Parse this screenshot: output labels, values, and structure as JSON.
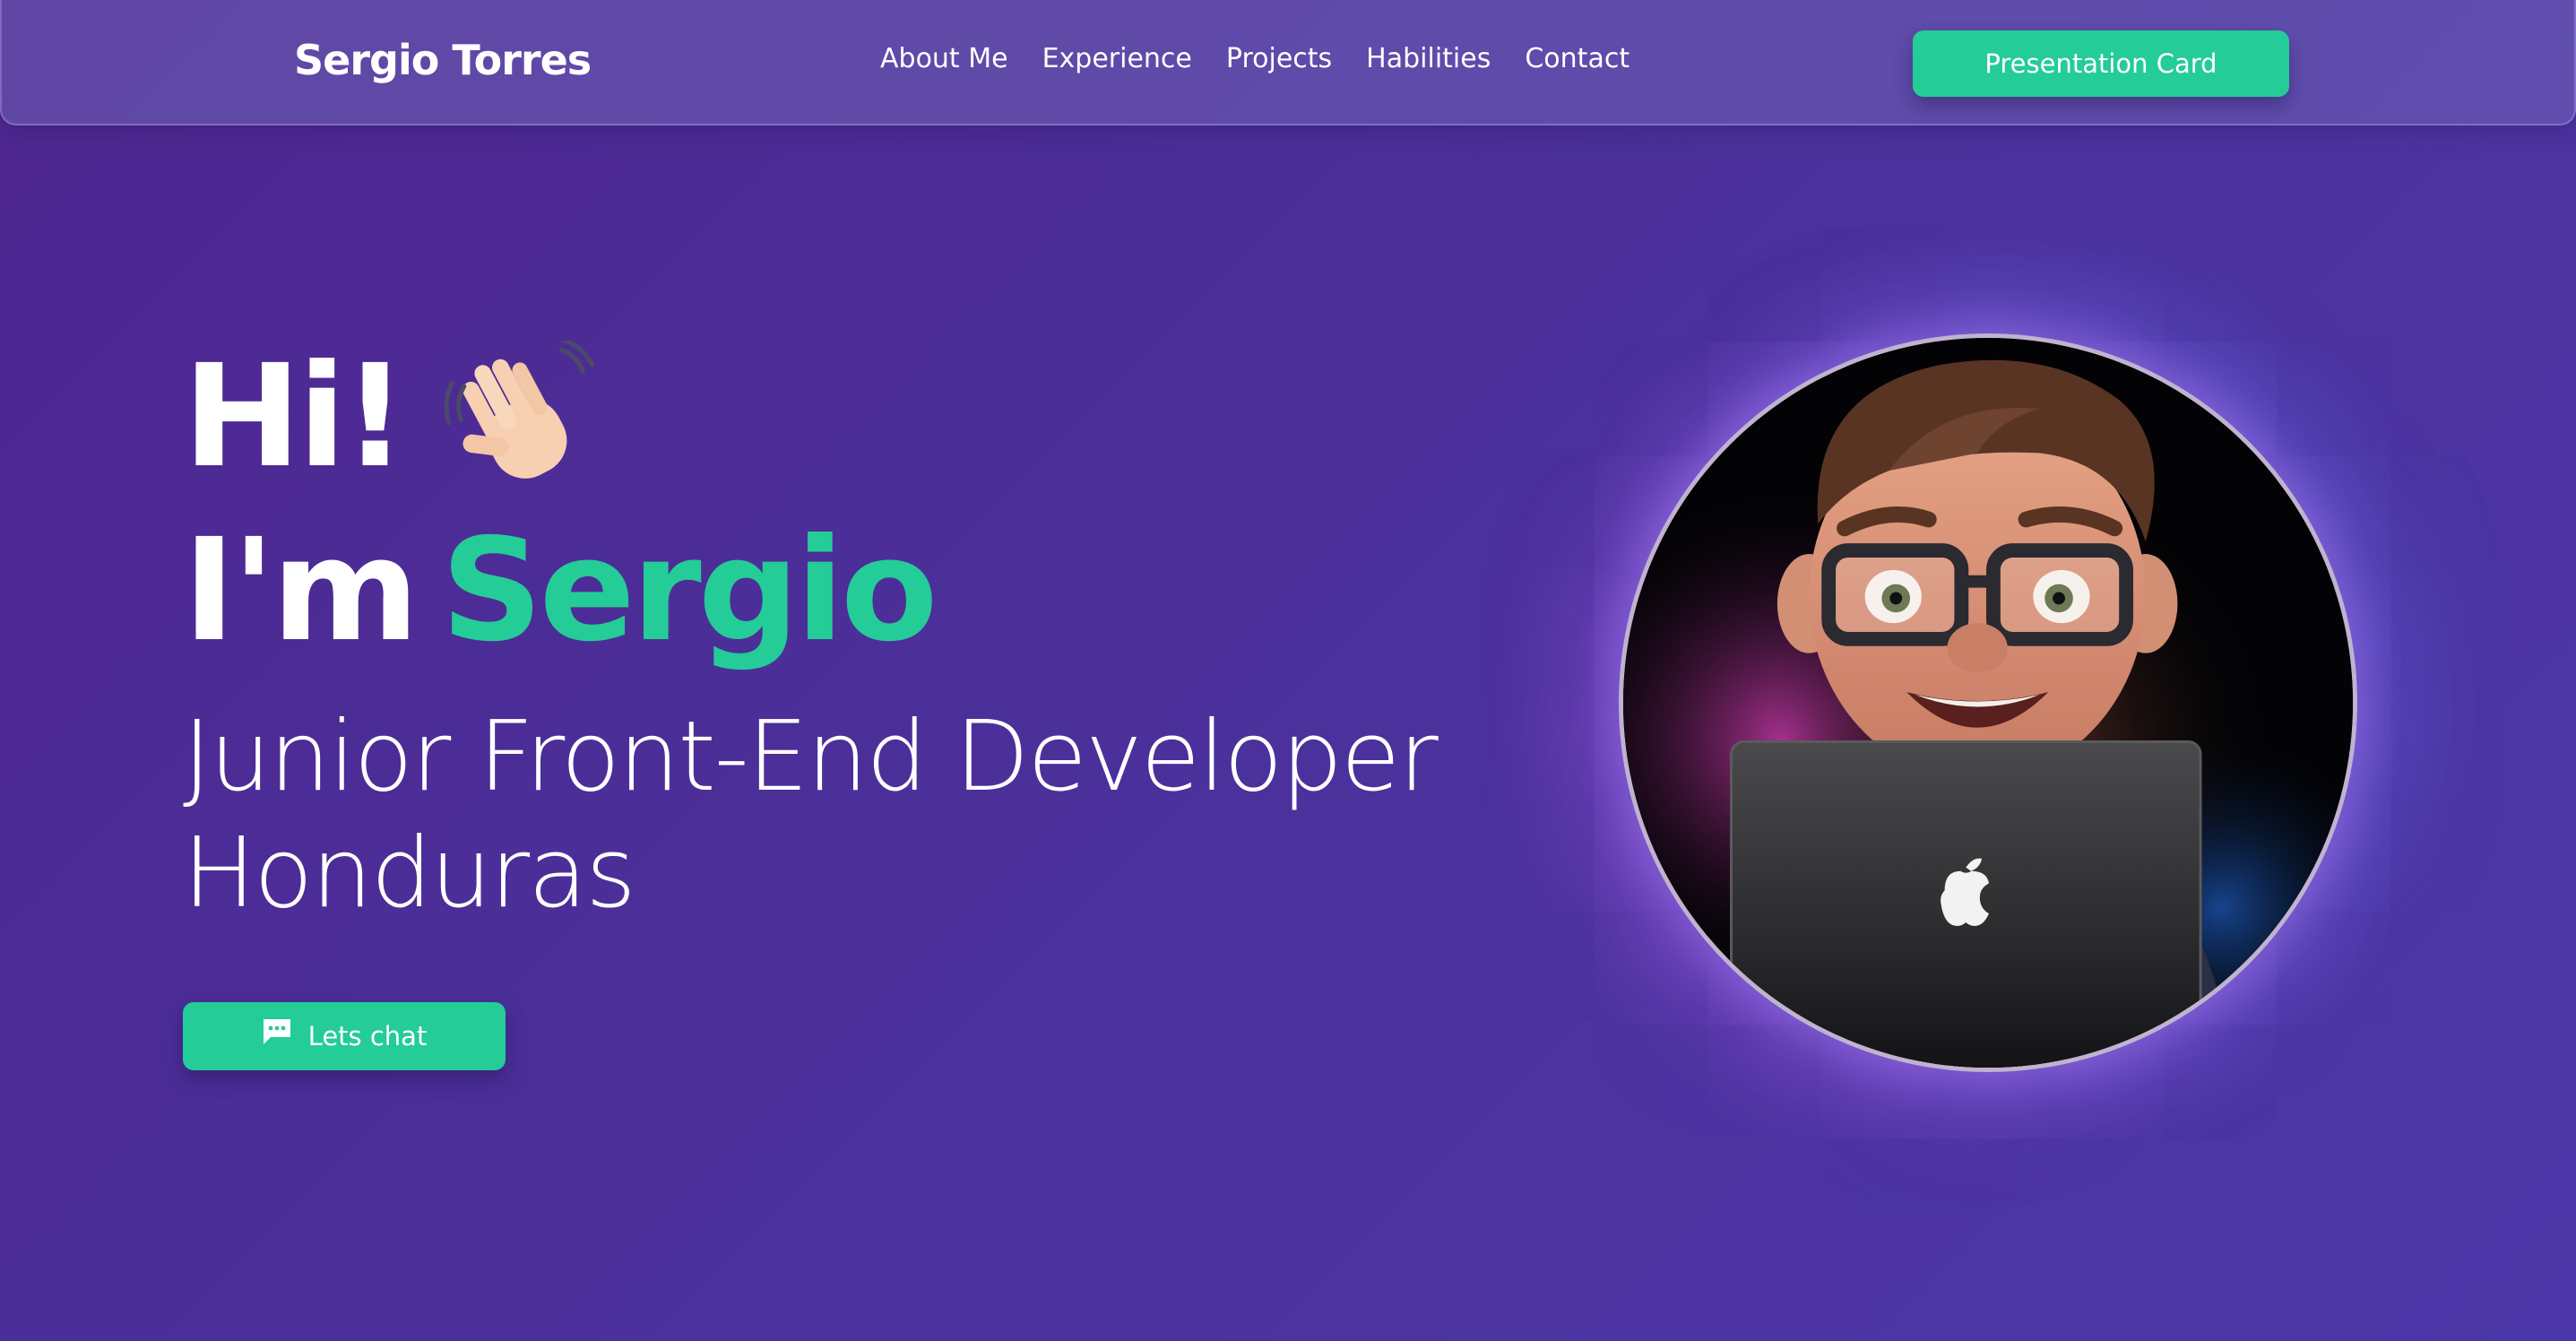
{
  "nav": {
    "brand": "Sergio Torres",
    "links": [
      {
        "label": "About Me"
      },
      {
        "label": "Experience"
      },
      {
        "label": "Projects"
      },
      {
        "label": "Habilities"
      },
      {
        "label": "Contact"
      }
    ],
    "cta_label": "Presentation Card"
  },
  "hero": {
    "greeting": "Hi!",
    "greeting_icon": "waving-hand-icon",
    "intro": "I'm",
    "name": "Sergio",
    "role_line1": "Junior Front-End Developer",
    "role_line2": "Honduras",
    "chat_button": {
      "label": "Lets chat",
      "icon": "chat-bubble-icon"
    },
    "avatar_alt": "memoji-avatar-with-laptop"
  },
  "colors": {
    "background_start": "#4f2690",
    "background_end": "#4c37a8",
    "accent": "#24cc98",
    "text": "#ffffff"
  }
}
